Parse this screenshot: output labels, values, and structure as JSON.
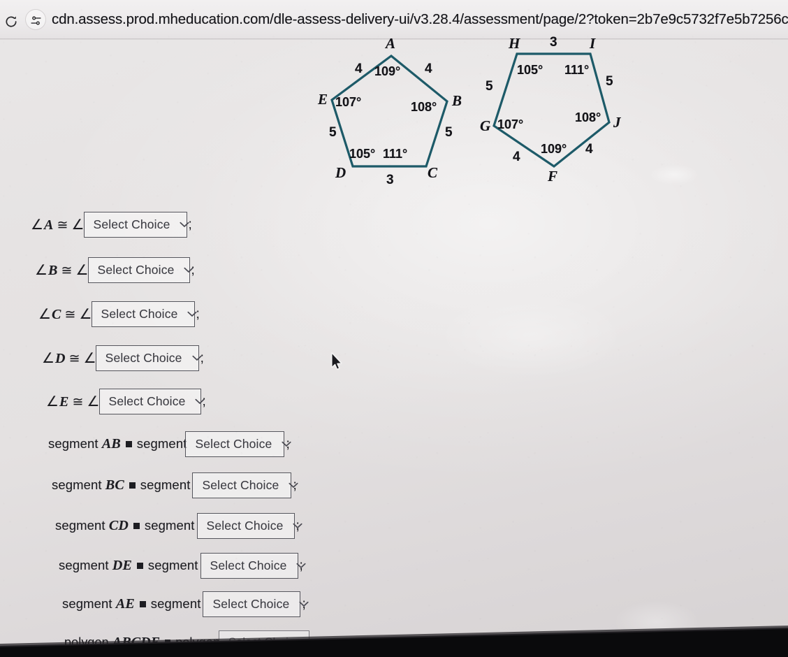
{
  "browser": {
    "reload_icon": "reload-icon",
    "site_info_icon": "site-settings-icon",
    "url": "cdn.assess.prod.mheducation.com/dle-assess-delivery-ui/v3.28.4/assessment/page/2?token=2b7e9c5732f7e5b7256cb2a0cf421eba"
  },
  "figure": {
    "stroke_color": "#1d5a68",
    "polygon1": {
      "name": "ABCDE",
      "vertices": [
        "A",
        "B",
        "C",
        "D",
        "E"
      ],
      "angles": [
        "109°",
        "108°",
        "111°",
        "105°",
        "107°"
      ],
      "sides": {
        "EA": "4",
        "AB": "4",
        "BC": "5",
        "CD": "3",
        "DE": "5"
      }
    },
    "polygon2": {
      "name": "FGHIJ",
      "vertices": [
        "F",
        "G",
        "H",
        "I",
        "J"
      ],
      "angles": [
        "109°",
        "107°",
        "105°",
        "111°",
        "108°"
      ],
      "sides": {
        "HI": "3",
        "IJ": "5",
        "JF": "4",
        "FG": "4",
        "GH": "5"
      }
    }
  },
  "select": {
    "placeholder": "Select Choice",
    "caret_icon": "chevron-down-icon"
  },
  "questions": {
    "angle_rows": [
      {
        "id": "angle-a",
        "lead_sym": "∠",
        "lead_letter": "A",
        "cong": "≅",
        "target_sym": "∠",
        "terminator": ";"
      },
      {
        "id": "angle-b",
        "lead_sym": "∠",
        "lead_letter": "B",
        "cong": "≅",
        "target_sym": "∠",
        "terminator": ";"
      },
      {
        "id": "angle-c",
        "lead_sym": "∠",
        "lead_letter": "C",
        "cong": "≅",
        "target_sym": "∠",
        "terminator": ";"
      },
      {
        "id": "angle-d",
        "lead_sym": "∠",
        "lead_letter": "D",
        "cong": "≅",
        "target_sym": "∠",
        "terminator": ";"
      },
      {
        "id": "angle-e",
        "lead_sym": "∠",
        "lead_letter": "E",
        "cong": "≅",
        "target_sym": "∠",
        "terminator": ";"
      }
    ],
    "segment_rows": [
      {
        "id": "segment-ab",
        "lead_word": "segment",
        "lead_letters": "AB",
        "cong": "≅",
        "target_word": "segment",
        "terminator": ";"
      },
      {
        "id": "segment-bc",
        "lead_word": "segment",
        "lead_letters": "BC",
        "cong": "≅",
        "target_word": "segment",
        "terminator": ";"
      },
      {
        "id": "segment-cd",
        "lead_word": "segment",
        "lead_letters": "CD",
        "cong": "≅",
        "target_word": "segment",
        "terminator": ";"
      },
      {
        "id": "segment-de",
        "lead_word": "segment",
        "lead_letters": "DE",
        "cong": "≅",
        "target_word": "segment",
        "terminator": ";"
      },
      {
        "id": "segment-ae",
        "lead_word": "segment",
        "lead_letters": "AE",
        "cong": "≅",
        "target_word": "segment",
        "terminator": ";"
      }
    ],
    "polygon_row": {
      "id": "polygon-abcde",
      "lead_word": "polygon",
      "lead_letters": "ABCDE",
      "cong": "≅",
      "target_word": "polygon"
    }
  }
}
